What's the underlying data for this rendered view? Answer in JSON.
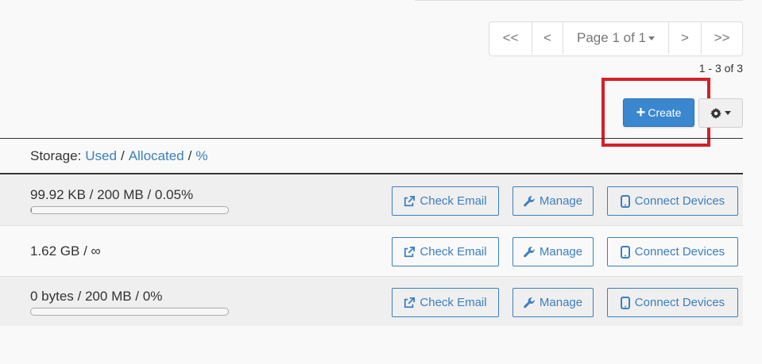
{
  "pagination": {
    "first": "<<",
    "prev": "<",
    "page_label": "Page 1 of 1",
    "next": ">",
    "last": ">>"
  },
  "result_count": "1 - 3 of 3",
  "toolbar": {
    "create_label": "Create",
    "create_icon": "plus-icon",
    "settings_icon": "gear-icon"
  },
  "table_header": {
    "prefix": "Storage:",
    "used": "Used",
    "allocated": "Allocated",
    "percent": "%",
    "separator": "/"
  },
  "actions": {
    "check_email": "Check Email",
    "manage": "Manage",
    "connect_devices": "Connect Devices"
  },
  "rows": [
    {
      "usage": "99.92 KB / 200 MB / 0.05%",
      "progress_percent": 0.05,
      "has_progress": true
    },
    {
      "usage": "1.62 GB / ∞",
      "progress_percent": null,
      "has_progress": false
    },
    {
      "usage": "0 bytes / 200 MB / 0%",
      "progress_percent": 0,
      "has_progress": true
    }
  ],
  "colors": {
    "primary": "#3a87d0",
    "link": "#3a7fc1",
    "highlight": "#d42027"
  }
}
